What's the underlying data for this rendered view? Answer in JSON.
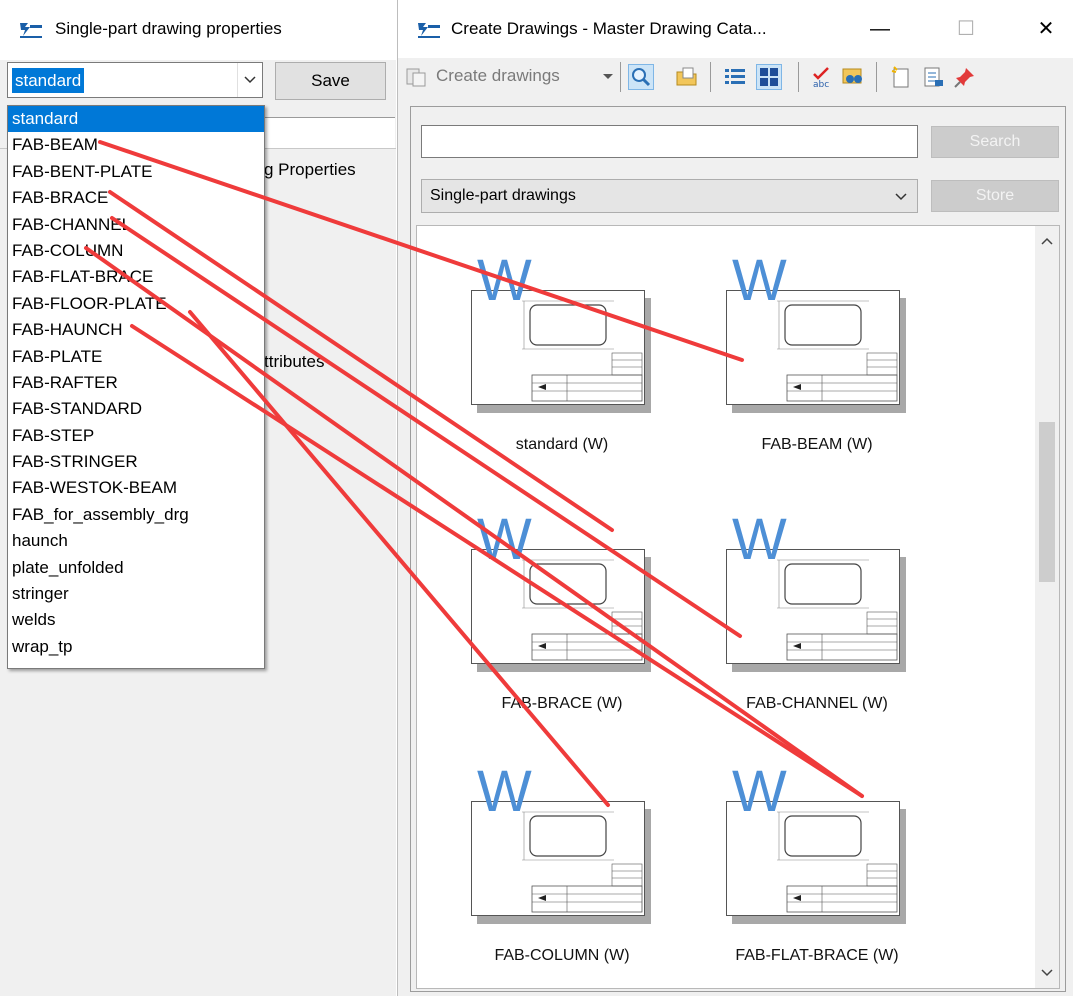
{
  "left_window": {
    "title": "Single-part drawing properties",
    "combo_value": "standard",
    "save_label": "Save",
    "partial_label_1": "g Properties",
    "partial_label_2": "ttributes",
    "dropdown_items": [
      "standard",
      "FAB-BEAM",
      "FAB-BENT-PLATE",
      "FAB-BRACE",
      "FAB-CHANNEL",
      "FAB-COLUMN",
      "FAB-FLAT-BRACE",
      "FAB-FLOOR-PLATE",
      "FAB-HAUNCH",
      "FAB-PLATE",
      "FAB-RAFTER",
      "FAB-STANDARD",
      "FAB-STEP",
      "FAB-STRINGER",
      "FAB-WESTOK-BEAM",
      "FAB_for_assembly_drg",
      "haunch",
      "plate_unfolded",
      "stringer",
      "welds",
      "wrap_tp"
    ],
    "selected_index": 0
  },
  "right_window": {
    "title": "Create Drawings - Master Drawing Cata...",
    "minimize_glyph": "—",
    "maximize_glyph": "☐",
    "close_glyph": "✕",
    "toolbar": {
      "create_label": "Create drawings",
      "icons": [
        "create-drawings-icon",
        "dropdown-arrow-icon",
        "search-icon",
        "copy-folder-icon",
        "list-view-icon",
        "thumbnail-view-icon",
        "spell-check-icon",
        "binoculars-icon",
        "new-document-icon",
        "document-edit-icon",
        "pin-icon"
      ]
    },
    "search": {
      "value": "",
      "button_label": "Search"
    },
    "type_select": {
      "value": "Single-part drawings"
    },
    "store_label": "Store",
    "tiles": [
      {
        "label": "standard (W)",
        "badge": "W"
      },
      {
        "label": "FAB-BEAM (W)",
        "badge": "W"
      },
      {
        "label": "FAB-BRACE (W)",
        "badge": "W"
      },
      {
        "label": "FAB-CHANNEL (W)",
        "badge": "W"
      },
      {
        "label": "FAB-COLUMN (W)",
        "badge": "W"
      },
      {
        "label": "FAB-FLAT-BRACE (W)",
        "badge": "W"
      }
    ]
  },
  "annotations": {
    "line_color": "#ef3b3b",
    "description_links": [
      "FAB-BEAM",
      "FAB-BRACE",
      "FAB-CHANNEL",
      "FAB-COLUMN",
      "FAB-FLAT-BRACE",
      "FAB-HAUNCH"
    ]
  }
}
